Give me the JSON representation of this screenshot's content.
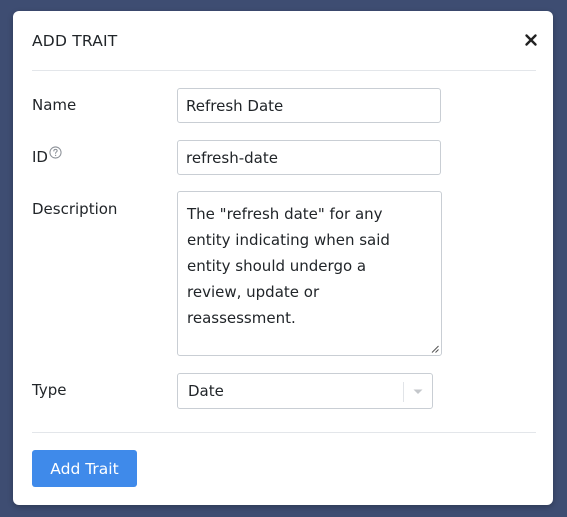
{
  "dialog": {
    "title": "ADD TRAIT",
    "close_icon": "close-icon"
  },
  "form": {
    "name": {
      "label": "Name",
      "value": "Refresh Date"
    },
    "id": {
      "label": "ID",
      "help_icon": "question-circle-icon",
      "value": "refresh-date"
    },
    "description": {
      "label": "Description",
      "lines": [
        "The \"refresh date\" for any",
        "entity indicating when said",
        "entity should undergo a",
        "review, update or",
        "reassessment."
      ]
    },
    "type": {
      "label": "Type",
      "selected": "Date"
    }
  },
  "footer": {
    "submit_label": "Add Trait"
  },
  "colors": {
    "backdrop": "#3e4d72",
    "primary": "#3f8aea",
    "border": "#c9ced4",
    "divider": "#e3e6ea"
  }
}
